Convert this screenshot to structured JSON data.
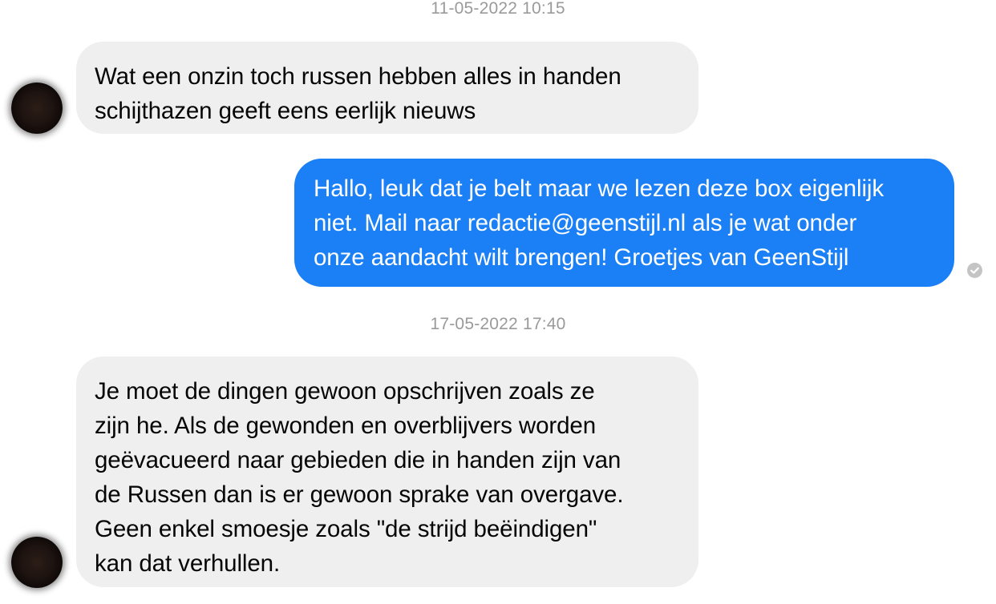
{
  "conversation": {
    "timestamps": [
      "11-05-2022 10:15",
      "17-05-2022 17:40"
    ],
    "messages": [
      {
        "direction": "incoming",
        "text": "Wat een onzin toch russen hebben alles in handen\nschijthazen geeft eens eerlijk nieuws"
      },
      {
        "direction": "outgoing",
        "text": "Hallo, leuk dat je belt maar we lezen deze box eigenlijk\nniet. Mail naar redactie@geenstijl.nl als je wat onder\nonze aandacht wilt brengen! Groetjes van GeenStijl"
      },
      {
        "direction": "incoming",
        "text": "Je moet de dingen gewoon opschrijven zoals ze\nzijn he. Als de gewonden en overblijvers worden\ngeëvacueerd naar gebieden die in handen zijn van\nde Russen dan is er gewoon sprake van overgave.\nGeen enkel smoesje zoals \"de strijd beëindigen\"\nkan dat verhullen."
      }
    ]
  },
  "colors": {
    "incoming_bubble": "#efefef",
    "outgoing_bubble": "#1b7ff5",
    "timestamp_text": "#9a9a9a"
  },
  "icons": {
    "seen_indicator": "check-circle-icon",
    "avatar": "contact-avatar"
  }
}
